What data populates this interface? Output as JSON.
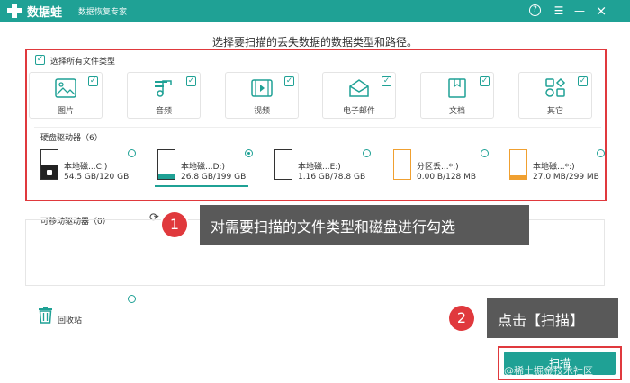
{
  "app": {
    "name": "数据蛙",
    "subtitle": "数据恢复专家"
  },
  "instruction": "选择要扫描的丢失数据的数据类型和路径。",
  "select_all": {
    "label": "选择所有文件类型",
    "checked": true
  },
  "file_types": [
    {
      "label": "图片",
      "icon": "image-icon",
      "checked": true
    },
    {
      "label": "音频",
      "icon": "music-icon",
      "checked": true
    },
    {
      "label": "视频",
      "icon": "video-icon",
      "checked": true
    },
    {
      "label": "电子邮件",
      "icon": "email-icon",
      "checked": true
    },
    {
      "label": "文档",
      "icon": "document-icon",
      "checked": true
    },
    {
      "label": "其它",
      "icon": "other-icon",
      "checked": true
    }
  ],
  "hard_drives": {
    "title": "硬盘驱动器（6）",
    "items": [
      {
        "name": "本地磁...C:)",
        "size": "54.5 GB/120 GB",
        "selected": false,
        "icon": "windows-drive-icon"
      },
      {
        "name": "本地磁...D:)",
        "size": "26.8 GB/199 GB",
        "selected": true,
        "icon": "drive-icon"
      },
      {
        "name": "本地磁...E:)",
        "size": "1.16 GB/78.8 GB",
        "selected": false,
        "icon": "drive-icon"
      },
      {
        "name": "分区丢...*:)",
        "size": "0.00  B/128 MB",
        "selected": false,
        "icon": "lost-partition-icon"
      },
      {
        "name": "本地磁...*:)",
        "size": "27.0 MB/299 MB",
        "selected": false,
        "icon": "drive-icon"
      }
    ]
  },
  "removable": {
    "title": "可移动驱动器（0）"
  },
  "recycle_bin": {
    "label": "回收站",
    "selected": false
  },
  "callouts": [
    {
      "number": "1",
      "text": "对需要扫描的文件类型和磁盘进行勾选"
    },
    {
      "number": "2",
      "text": "点击【扫描】"
    }
  ],
  "scan_button": "扫描",
  "watermark": "@稀土掘金技术社区",
  "colors": {
    "accent": "#1fa195",
    "highlight": "#e0393d",
    "callout_bg": "#595959",
    "drive_fill_orange": "#f0a030"
  }
}
